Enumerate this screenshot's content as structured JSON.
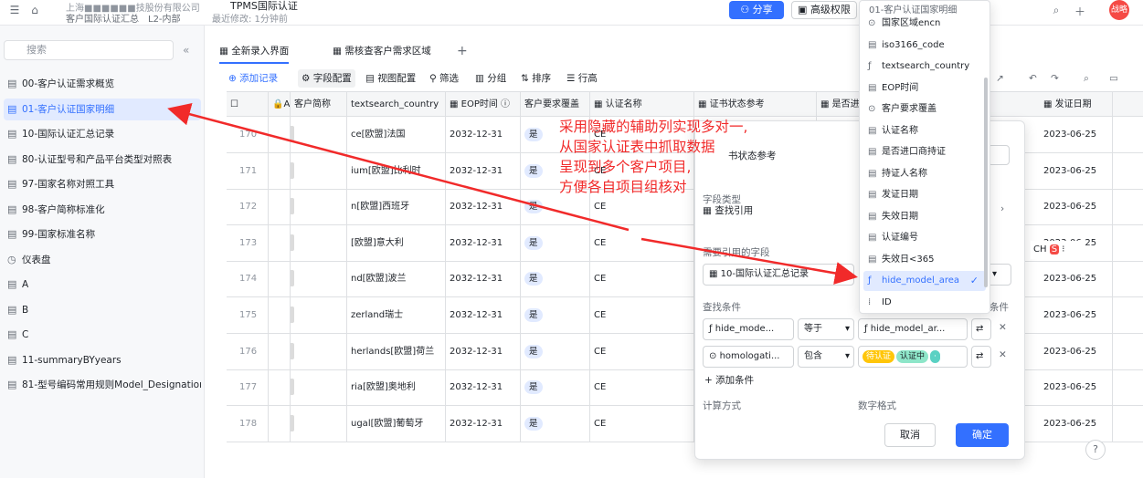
{
  "topbar": {
    "company": "上海■■■■■■技股份有限公司",
    "doc_title": "TPMS国际认证",
    "folder": "客户国际认证汇总",
    "badge": "L2-内部",
    "edited": "最近修改: 1分钟前",
    "share_label": "分享",
    "perm_label": "高级权限",
    "avatar_text": "战略"
  },
  "sidebar": {
    "search_placeholder": "搜索",
    "items": [
      {
        "label": "00-客户认证需求概览",
        "icon": "table-icon"
      },
      {
        "label": "01-客户认证国家明细",
        "icon": "table-icon",
        "active": true
      },
      {
        "label": "10-国际认证汇总记录",
        "icon": "table-icon"
      },
      {
        "label": "80-认证型号和产品平台类型对照表",
        "icon": "table-icon"
      },
      {
        "label": "97-国家名称对照工具",
        "icon": "table-icon"
      },
      {
        "label": "98-客户简称标准化",
        "icon": "table-icon"
      },
      {
        "label": "99-国家标准名称",
        "icon": "table-icon"
      },
      {
        "label": "仪表盘",
        "icon": "dashboard-icon"
      },
      {
        "label": "A",
        "icon": "table-icon"
      },
      {
        "label": "B",
        "icon": "table-icon"
      },
      {
        "label": "C",
        "icon": "table-icon"
      },
      {
        "label": "11-summaryBYyears",
        "icon": "table-icon"
      },
      {
        "label": "81-型号编码常用规则Model_Designation",
        "icon": "table-icon"
      }
    ]
  },
  "tabs": [
    {
      "label": "全新录入界面",
      "active": true
    },
    {
      "label": "需核查客户需求区域",
      "active": false
    }
  ],
  "toolbar": {
    "add": "添加记录",
    "field_config": "字段配置",
    "view_config": "视图配置",
    "filter": "筛选",
    "group": "分组",
    "sort": "排序",
    "row_height": "行高"
  },
  "grid": {
    "headers": [
      "客户简称",
      "textsearch_country",
      "EOP时间",
      "客户要求覆盖",
      "认证名称",
      "证书状态参考",
      "是否进",
      "发证日期"
    ],
    "header_a": "A",
    "rows": [
      {
        "n": "170",
        "country": "ce[欧盟]法国",
        "eop": "2032-12-31",
        "cover": "是",
        "cert": "CE",
        "date": "2023-06-25"
      },
      {
        "n": "171",
        "country": "ium[欧盟]比利时",
        "eop": "2032-12-31",
        "cover": "是",
        "cert": "CE",
        "date": "2023-06-25"
      },
      {
        "n": "172",
        "country": "n[欧盟]西班牙",
        "eop": "2032-12-31",
        "cover": "是",
        "cert": "CE",
        "date": "2023-06-25"
      },
      {
        "n": "173",
        "country": "[欧盟]意大利",
        "eop": "2032-12-31",
        "cover": "是",
        "cert": "CE",
        "date": "2023-06-25"
      },
      {
        "n": "174",
        "country": "nd[欧盟]波兰",
        "eop": "2032-12-31",
        "cover": "是",
        "cert": "CE",
        "date": "2023-06-25"
      },
      {
        "n": "175",
        "country": "zerland瑞士",
        "eop": "2032-12-31",
        "cover": "是",
        "cert": "CE",
        "date": "2023-06-25"
      },
      {
        "n": "176",
        "country": "herlands[欧盟]荷兰",
        "eop": "2032-12-31",
        "cover": "是",
        "cert": "CE",
        "date": "2023-06-25"
      },
      {
        "n": "177",
        "country": "ria[欧盟]奥地利",
        "eop": "2032-12-31",
        "cover": "是",
        "cert": "CE",
        "date": "2023-06-25"
      },
      {
        "n": "178",
        "country": "ugal[欧盟]葡萄牙",
        "eop": "2032-12-31",
        "cover": "是",
        "cert": "CE",
        "date": "2023-06-25"
      }
    ]
  },
  "panel": {
    "field_type_label": "字段类型",
    "field_type_value": "查找引用",
    "ref_field_label": "需要引用的字段",
    "ref_table": "10-国际认证汇总记录",
    "lookup_cond_label": "查找条件",
    "cond_suffix": "条件",
    "cond1_field": "hide_mode...",
    "cond1_op": "等于",
    "cond1_value": "hide_model_ar...",
    "cond2_field": "homologati...",
    "cond2_op": "包含",
    "tag1": "待认证",
    "tag2": "认证中",
    "add_cond": "添加条件",
    "calc_label": "计算方式",
    "num_format_label": "数字格式",
    "field_name_partial": "书状态参考",
    "cancel": "取消",
    "ok": "确定"
  },
  "dropdown": {
    "header": "01-客户认证国家明细",
    "items": [
      {
        "label": "国家区域encn",
        "icon": "option-icon"
      },
      {
        "label": "iso3166_code",
        "icon": "table-icon"
      },
      {
        "label": "textsearch_country",
        "icon": "formula-icon"
      },
      {
        "label": "EOP时间",
        "icon": "table-icon"
      },
      {
        "label": "客户要求覆盖",
        "icon": "option-icon"
      },
      {
        "label": "认证名称",
        "icon": "table-icon"
      },
      {
        "label": "是否进口商持证",
        "icon": "table-icon"
      },
      {
        "label": "持证人名称",
        "icon": "table-icon"
      },
      {
        "label": "发证日期",
        "icon": "table-icon"
      },
      {
        "label": "失效日期",
        "icon": "table-icon"
      },
      {
        "label": "认证编号",
        "icon": "table-icon"
      },
      {
        "label": "失效日<365",
        "icon": "table-icon"
      },
      {
        "label": "hide_model_area",
        "icon": "formula-icon",
        "selected": true
      },
      {
        "label": "ID",
        "icon": "id-icon"
      }
    ]
  },
  "annotation": [
    "采用隐藏的辅助列实现多对一,",
    "从国家认证表中抓取数据",
    "呈现到多个客户项目,",
    "方便各自项目组核对"
  ],
  "ime_text": "CH"
}
